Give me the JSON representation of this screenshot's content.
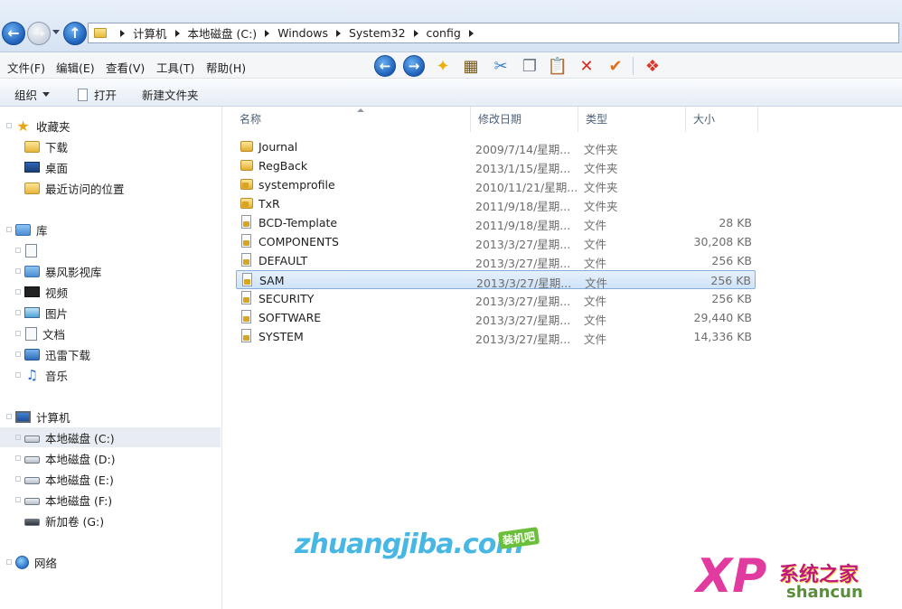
{
  "address": {
    "crumbs": [
      "计算机",
      "本地磁盘 (C:)",
      "Windows",
      "System32",
      "config"
    ]
  },
  "menu": {
    "file": "文件(F)",
    "edit": "编辑(E)",
    "view": "查看(V)",
    "tools": "工具(T)",
    "help": "帮助(H)"
  },
  "command": {
    "organize": "组织",
    "open": "打开",
    "new_folder": "新建文件夹"
  },
  "sidebar": {
    "favorites": "收藏夹",
    "downloads": "下载",
    "desktop": "桌面",
    "recent": "最近访问的位置",
    "libraries": "库",
    "baofeng": "暴风影视库",
    "videos": "视频",
    "pictures": "图片",
    "documents": "文档",
    "xunlei": "迅雷下载",
    "music": "音乐",
    "computer": "计算机",
    "drive_c": "本地磁盘 (C:)",
    "drive_d": "本地磁盘 (D:)",
    "drive_e": "本地磁盘 (E:)",
    "drive_f": "本地磁盘 (F:)",
    "drive_g": "新加卷 (G:)",
    "network": "网络"
  },
  "columns": {
    "name": "名称",
    "date": "修改日期",
    "type": "类型",
    "size": "大小"
  },
  "files": [
    {
      "name": "Journal",
      "date": "2009/7/14/星期...",
      "type": "文件夹",
      "size": "",
      "kind": "folder"
    },
    {
      "name": "RegBack",
      "date": "2013/1/15/星期...",
      "type": "文件夹",
      "size": "",
      "kind": "folder"
    },
    {
      "name": "systemprofile",
      "date": "2010/11/21/星期...",
      "type": "文件夹",
      "size": "",
      "kind": "folder-locked"
    },
    {
      "name": "TxR",
      "date": "2011/9/18/星期...",
      "type": "文件夹",
      "size": "",
      "kind": "folder-locked"
    },
    {
      "name": "BCD-Template",
      "date": "2011/9/18/星期...",
      "type": "文件",
      "size": "28 KB",
      "kind": "file"
    },
    {
      "name": "COMPONENTS",
      "date": "2013/3/27/星期...",
      "type": "文件",
      "size": "30,208 KB",
      "kind": "file"
    },
    {
      "name": "DEFAULT",
      "date": "2013/3/27/星期...",
      "type": "文件",
      "size": "256 KB",
      "kind": "file"
    },
    {
      "name": "SAM",
      "date": "2013/3/27/星期...",
      "type": "文件",
      "size": "256 KB",
      "kind": "file",
      "selected": true
    },
    {
      "name": "SECURITY",
      "date": "2013/3/27/星期...",
      "type": "文件",
      "size": "256 KB",
      "kind": "file"
    },
    {
      "name": "SOFTWARE",
      "date": "2013/3/27/星期...",
      "type": "文件",
      "size": "29,440 KB",
      "kind": "file"
    },
    {
      "name": "SYSTEM",
      "date": "2013/3/27/星期...",
      "type": "文件",
      "size": "14,336 KB",
      "kind": "file"
    }
  ],
  "watermarks": {
    "zhuangjiba": "zhuangjiba.com",
    "zhuangjiba_tag": "装机吧",
    "xp": "XP",
    "xp_cn": "系统之家",
    "shancun": "shancun"
  }
}
